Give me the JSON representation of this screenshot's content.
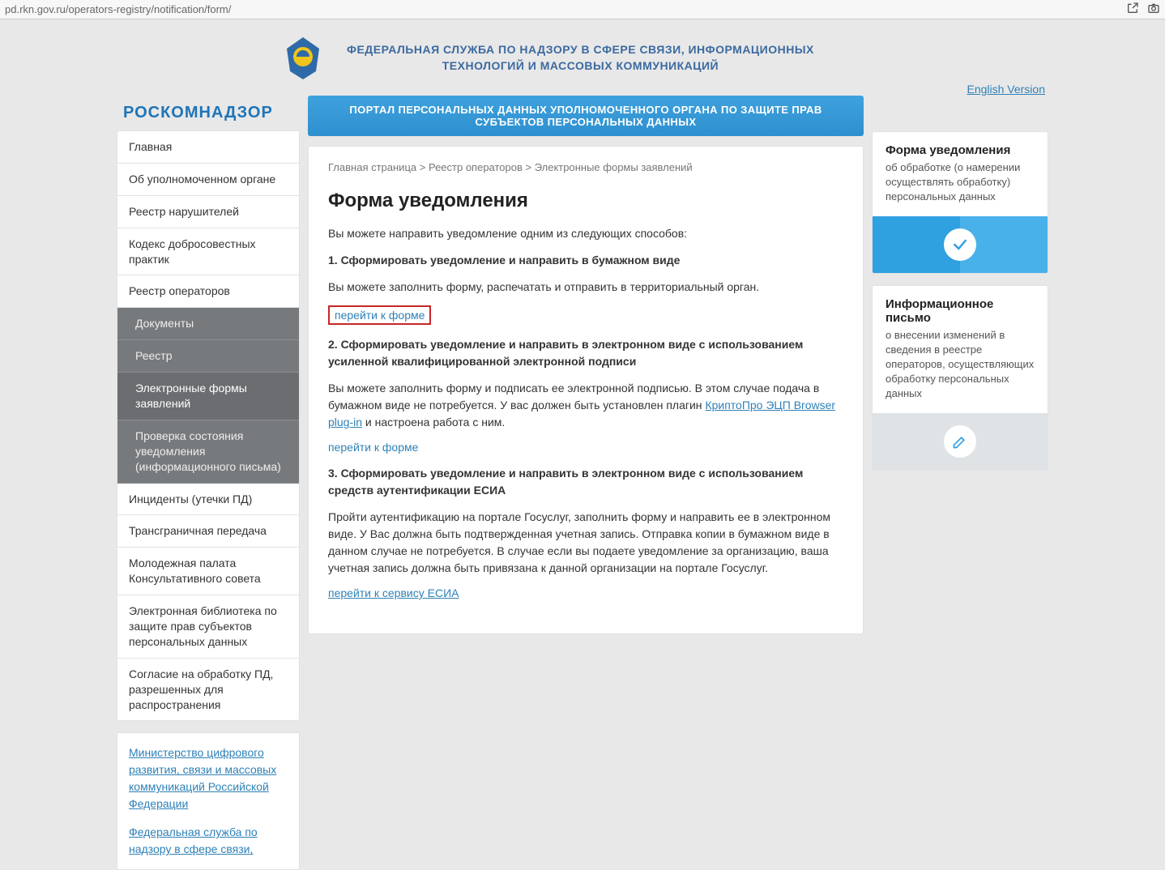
{
  "browser": {
    "url": "pd.rkn.gov.ru/operators-registry/notification/form/"
  },
  "header": {
    "agency_line1": "ФЕДЕРАЛЬНАЯ СЛУЖБА ПО НАДЗОРУ В СФЕРЕ СВЯЗИ, ИНФОРМАЦИОННЫХ",
    "agency_line2": "ТЕХНОЛОГИЙ И МАССОВЫХ КОММУНИКАЦИЙ",
    "english_link": "English Version",
    "brand": "РОСКОМНАДЗОР",
    "portal_bar": "ПОРТАЛ ПЕРСОНАЛЬНЫХ ДАННЫХ УПОЛНОМОЧЕННОГО ОРГАНА ПО ЗАЩИТЕ ПРАВ СУБЪЕКТОВ ПЕРСОНАЛЬНЫХ ДАННЫХ"
  },
  "sidebar": {
    "items": [
      "Главная",
      "Об уполномоченном органе",
      "Реестр нарушителей",
      "Кодекс добросовестных практик",
      "Реестр операторов",
      "Документы",
      "Реестр",
      "Электронные формы заявлений",
      "Проверка состояния уведомления (информационного письма)",
      "Инциденты (утечки ПД)",
      "Трансграничная передача",
      "Молодежная палата Консультативного совета",
      "Электронная библиотека по защите прав субъектов персональных данных",
      "Согласие на обработку ПД, разрешенных для распространения"
    ]
  },
  "ext_links": {
    "link1": "Министерство цифрового развития, связи и массовых коммуникаций Российской Федерации",
    "link2": "Федеральная служба по надзору в сфере связи,"
  },
  "breadcrumb": {
    "a": "Главная страница",
    "sep": " > ",
    "b": "Реестр операторов",
    "c": "Электронные формы заявлений"
  },
  "content": {
    "h1": "Форма уведомления",
    "intro": "Вы можете направить уведомление одним из следующих способов:",
    "s1_title": "1. Сформировать уведомление и направить в бумажном виде",
    "s1_text": "Вы можете заполнить форму, распечатать и отправить в территориальный орган.",
    "s1_link": "перейти к форме",
    "s2_title": "2. Сформировать уведомление и направить в электронном виде с использованием усиленной квалифицированной электронной подписи",
    "s2_text_a": "Вы можете заполнить форму и подписать ее электронной подписью. В этом случае подача в бумажном виде не потребуется. У вас должен быть установлен плагин ",
    "s2_plugin": "КриптоПро ЭЦП Browser plug-in",
    "s2_text_b": " и настроена работа с ним.",
    "s2_link": "перейти к форме",
    "s3_title": "3. Сформировать уведомление и направить в электронном виде с использованием средств аутентификации ЕСИА",
    "s3_text": "Пройти аутентификацию на портале Госуслуг, заполнить форму и направить ее в электронном виде. У Вас должна быть подтвержденная учетная запись. Отправка копии в бумажном виде в данном случае не потребуется. В случае если вы подаете уведомление за организацию, ваша учетная запись должна быть привязана к данной организации на портале Госуслуг.",
    "s3_link": "перейти к сервису ЕСИА"
  },
  "widgets": {
    "w1_title": "Форма уведомления",
    "w1_sub": "об обработке (о намерении осуществлять обработку) персональных данных",
    "w2_title": "Информационное письмо",
    "w2_sub": "о внесении изменений в сведения в реестре операторов, осуществляющих обработку персональных данных"
  }
}
